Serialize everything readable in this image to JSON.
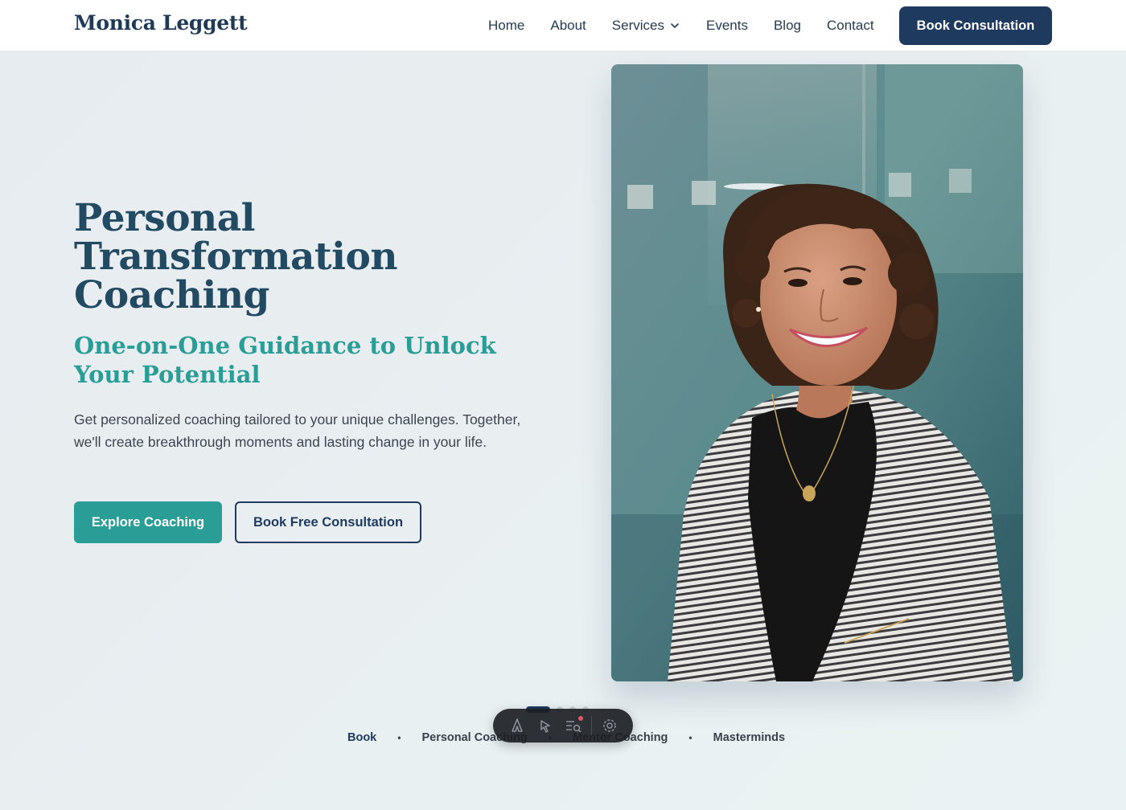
{
  "brand": {
    "name": "Monica Leggett"
  },
  "nav": {
    "links": [
      "Home",
      "About",
      "Services",
      "Events",
      "Blog",
      "Contact"
    ],
    "cta": "Book Consultation"
  },
  "hero": {
    "title": "Personal Transformation Coaching",
    "subtitle": "One-on-One Guidance to Unlock Your Potential",
    "description": "Get personalized coaching tailored to your unique challenges. Together, we'll create breakthrough moments and lasting change in your life.",
    "primary_button": "Explore Coaching",
    "secondary_button": "Book Free Consultation",
    "image_alt": "Smiling woman with curly hair in striped jacket"
  },
  "carousel": {
    "count": 4,
    "active": 0
  },
  "bottom_nav": [
    "Book",
    "Personal Coaching",
    "Mentor Coaching",
    "Masterminds"
  ],
  "toolbar": {
    "items": [
      "astro-icon",
      "cursor-icon",
      "audit-icon",
      "settings-icon"
    ]
  },
  "colors": {
    "navy": "#1e3a5f",
    "teal": "#2a9d96",
    "title": "#234a63"
  }
}
